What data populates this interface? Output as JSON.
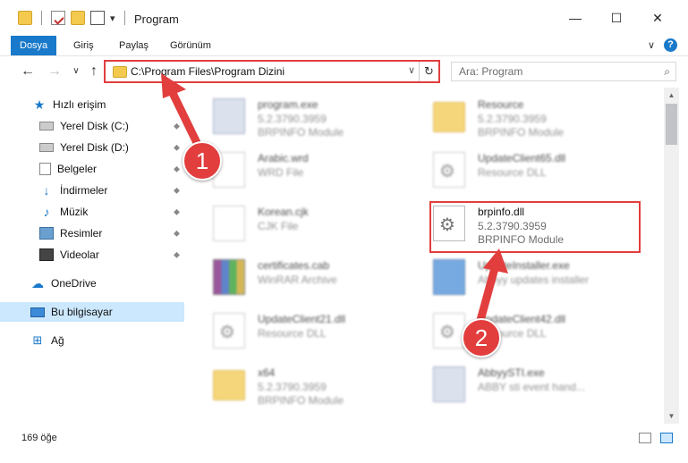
{
  "window": {
    "title": "Program",
    "minimize": "—",
    "maximize": "☐",
    "close": "✕"
  },
  "ribbon": {
    "tabs": [
      {
        "label": "Dosya",
        "active": true
      },
      {
        "label": "Giriş"
      },
      {
        "label": "Paylaş"
      },
      {
        "label": "Görünüm"
      }
    ],
    "expand_icon": "∨",
    "help_icon": "?"
  },
  "nav": {
    "back": "←",
    "forward": "→",
    "recent": "∨",
    "up": "↑",
    "address": "C:\\Program Files\\Program Dizini",
    "address_dropdown": "∨",
    "refresh": "↻",
    "search_placeholder": "Ara: Program",
    "search_icon": "⌕"
  },
  "sidebar": {
    "items": [
      {
        "label": "Hızlı erişim",
        "icon": "star-icon",
        "glyph": "★"
      },
      {
        "label": "Yerel Disk (C:)",
        "icon": "disk-icon",
        "pinned": true
      },
      {
        "label": "Yerel Disk (D:)",
        "icon": "disk-icon",
        "pinned": true
      },
      {
        "label": "Belgeler",
        "icon": "documents-icon",
        "pinned": true
      },
      {
        "label": "İndirmeler",
        "icon": "download-icon",
        "glyph": "↓",
        "pinned": true
      },
      {
        "label": "Müzik",
        "icon": "music-icon",
        "glyph": "♪",
        "pinned": true
      },
      {
        "label": "Resimler",
        "icon": "pictures-icon",
        "pinned": true
      },
      {
        "label": "Videolar",
        "icon": "videos-icon",
        "pinned": true
      },
      {
        "label": "OneDrive",
        "icon": "cloud-icon",
        "glyph": "☁"
      },
      {
        "label": "Bu bilgisayar",
        "icon": "computer-icon",
        "selected": true
      },
      {
        "label": "Ağ",
        "icon": "network-icon",
        "glyph": "⊞"
      }
    ],
    "pin_glyph": "📌"
  },
  "files": [
    {
      "name": "program.exe",
      "line2": "5.2.3790.3959",
      "line3": "BRPINFO Module",
      "icon": "exe-icon"
    },
    {
      "name": "Resource",
      "line2": "5.2.3790.3959",
      "line3": "BRPINFO Module",
      "icon": "folder-icon"
    },
    {
      "name": "Arabic.wrd",
      "line2": "WRD File",
      "line3": "",
      "icon": "document-icon"
    },
    {
      "name": "UpdateClient65.dll",
      "line2": "Resource DLL",
      "line3": "",
      "icon": "dll-icon"
    },
    {
      "name": "Korean.cjk",
      "line2": "CJK File",
      "line3": "",
      "icon": "document-icon"
    },
    {
      "name": "brpinfo.dll",
      "line2": "5.2.3790.3959",
      "line3": "BRPINFO Module",
      "icon": "dll-icon"
    },
    {
      "name": "certificates.cab",
      "line2": "WinRAR Archive",
      "line3": "",
      "icon": "rar-icon"
    },
    {
      "name": "UpdateInstaller.exe",
      "line2": "Abbyy updates installer",
      "line3": "",
      "icon": "installer-icon"
    },
    {
      "name": "UpdateClient21.dll",
      "line2": "Resource DLL",
      "line3": "",
      "icon": "dll-icon"
    },
    {
      "name": "UpdateClient42.dll",
      "line2": "Resource DLL",
      "line3": "",
      "icon": "dll-icon"
    },
    {
      "name": "x64",
      "line2": "5.2.3790.3959",
      "line3": "BRPINFO Module",
      "icon": "folder-icon"
    },
    {
      "name": "AbbyySTI.exe",
      "line2": "ABBY sti event hand...",
      "line3": "",
      "icon": "exe-icon"
    }
  ],
  "annotations": {
    "badge1": "1",
    "badge2": "2",
    "color": "#e23e3e"
  },
  "status": {
    "count": "169 öğe"
  },
  "colors": {
    "accent": "#1979ca",
    "selection": "#cce8ff",
    "highlight": "#e23e3e"
  }
}
